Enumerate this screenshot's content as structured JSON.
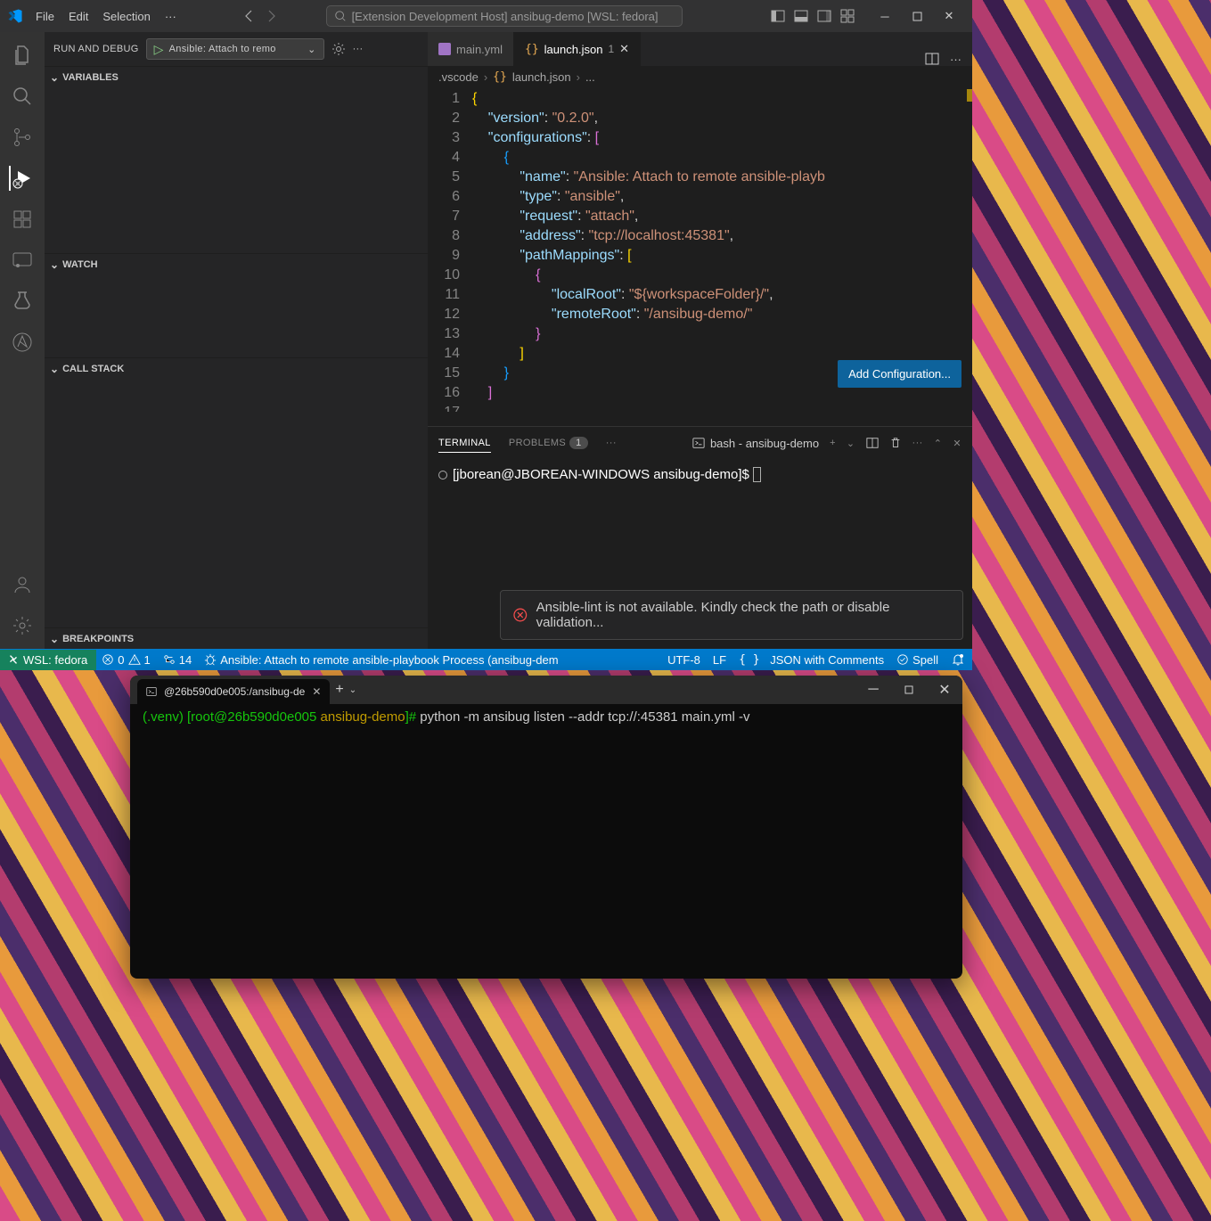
{
  "titlebar": {
    "menu": [
      "File",
      "Edit",
      "Selection"
    ],
    "overflow": "···",
    "search": "[Extension Development Host] ansibug-demo [WSL: fedora]"
  },
  "debug": {
    "title": "RUN AND DEBUG",
    "config": "Ansible: Attach to remo"
  },
  "panels": {
    "variables": "VARIABLES",
    "watch": "WATCH",
    "callstack": "CALL STACK",
    "breakpoints": "BREAKPOINTS"
  },
  "tabs": {
    "main": "main.yml",
    "launch": "launch.json",
    "launch_dirty": "1"
  },
  "breadcrumbs": {
    "folder": ".vscode",
    "file": "launch.json",
    "trail": "..."
  },
  "code_prefix": "    \"configurations\": [\n        {",
  "code_lines": [
    [
      [
        "b",
        "{"
      ]
    ],
    [
      [
        "p",
        "    "
      ],
      [
        "k",
        "\"version\""
      ],
      [
        "p",
        ": "
      ],
      [
        "s",
        "\"0.2.0\""
      ],
      [
        "p",
        ","
      ]
    ],
    [
      [
        "p",
        "    "
      ],
      [
        "k",
        "\"configurations\""
      ],
      [
        "p",
        ": "
      ],
      [
        "bp",
        "["
      ]
    ],
    [
      [
        "p",
        "        "
      ],
      [
        "bb",
        "{"
      ]
    ],
    [
      [
        "p",
        "            "
      ],
      [
        "k",
        "\"name\""
      ],
      [
        "p",
        ": "
      ],
      [
        "s",
        "\"Ansible: Attach to remote ansible-playb"
      ]
    ],
    [
      [
        "p",
        "            "
      ],
      [
        "k",
        "\"type\""
      ],
      [
        "p",
        ": "
      ],
      [
        "s",
        "\"ansible\""
      ],
      [
        "p",
        ","
      ]
    ],
    [
      [
        "p",
        "            "
      ],
      [
        "k",
        "\"request\""
      ],
      [
        "p",
        ": "
      ],
      [
        "s",
        "\"attach\""
      ],
      [
        "p",
        ","
      ]
    ],
    [
      [
        "p",
        "            "
      ],
      [
        "k",
        "\"address\""
      ],
      [
        "p",
        ": "
      ],
      [
        "s",
        "\"tcp://localhost:45381\""
      ],
      [
        "p",
        ","
      ]
    ],
    [
      [
        "p",
        "            "
      ],
      [
        "k",
        "\"pathMappings\""
      ],
      [
        "p",
        ": "
      ],
      [
        "b",
        "["
      ]
    ],
    [
      [
        "p",
        "                "
      ],
      [
        "bp",
        "{"
      ]
    ],
    [
      [
        "p",
        "                    "
      ],
      [
        "k",
        "\"localRoot\""
      ],
      [
        "p",
        ": "
      ],
      [
        "s",
        "\"${workspaceFolder}/\""
      ],
      [
        "p",
        ","
      ]
    ],
    [
      [
        "p",
        "                    "
      ],
      [
        "k",
        "\"remoteRoot\""
      ],
      [
        "p",
        ": "
      ],
      [
        "s",
        "\"/ansibug-demo/\""
      ]
    ],
    [
      [
        "p",
        "                "
      ],
      [
        "bp",
        "}"
      ]
    ],
    [
      [
        "p",
        "            "
      ],
      [
        "b",
        "]"
      ]
    ],
    [
      [
        "p",
        "        "
      ],
      [
        "bb",
        "}"
      ]
    ],
    [
      [
        "p",
        "    "
      ],
      [
        "bp",
        "]"
      ]
    ]
  ],
  "add_config_btn": "Add Configuration...",
  "panel": {
    "terminal": "TERMINAL",
    "problems": "PROBLEMS",
    "problems_count": "1",
    "term_name": "bash - ansibug-demo"
  },
  "terminal": {
    "prompt": "[jborean@JBOREAN-WINDOWS ansibug-demo]$ "
  },
  "toast": "Ansible-lint is not available. Kindly check the path or disable validation...",
  "status": {
    "remote": "WSL: fedora",
    "errors": "0",
    "warnings": "1",
    "ports": "14",
    "debug_target": "Ansible: Attach to remote ansible-playbook Process (ansibug-dem",
    "encoding": "UTF-8",
    "eol": "LF",
    "lang": "JSON with Comments",
    "spell": "Spell"
  },
  "extterm": {
    "tab": "@26b590d0e005:/ansibug-de",
    "venv": "(.venv) ",
    "userhost": "[root@26b590d0e005 ",
    "dir": "ansibug-demo",
    "bracket": "]# ",
    "cmd": "python -m ansibug listen --addr tcp://:45381 main.yml -v"
  }
}
